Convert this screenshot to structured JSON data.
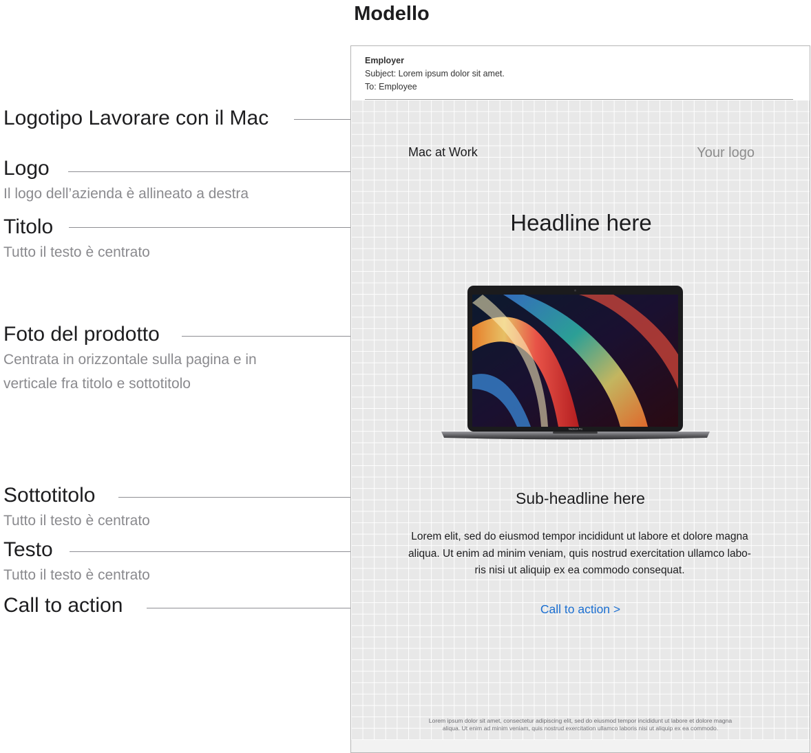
{
  "page": {
    "title": "Modello"
  },
  "annotations": {
    "logotipo": {
      "label": "Logotipo Lavorare con il Mac"
    },
    "logo": {
      "label": "Logo",
      "desc": "Il logo dell’azienda è allineato a destra"
    },
    "titolo": {
      "label": "Titolo",
      "desc": "Tutto il testo è centrato"
    },
    "foto": {
      "label": "Foto del prodotto",
      "desc_line1": "Centrata in orizzontale sulla pagina e in",
      "desc_line2": "verticale fra titolo e sottotitolo"
    },
    "sottotitolo": {
      "label": "Sottotitolo",
      "desc": "Tutto il testo è centrato"
    },
    "testo": {
      "label": "Testo",
      "desc": "Tutto il testo è centrato"
    },
    "cta": {
      "label": "Call to action"
    }
  },
  "email": {
    "from": "Employer",
    "subject": "Subject: Lorem ipsum dolor sit amet.",
    "to": "To: Employee",
    "mac_at_work": "Mac at Work",
    "your_logo": "Your logo",
    "headline": "Headline here",
    "laptop_brand": "MacBook Pro",
    "subheadline": "Sub-headline here",
    "body_line1": "Lorem elit, sed do eiusmod tempor incididunt ut labore et dolore magna",
    "body_line2": "aliqua. Ut enim ad minim veniam, quis nostrud exercitation ullamco labo-",
    "body_line3": "ris nisi ut aliquip ex ea commodo consequat.",
    "cta": "Call to action >",
    "footer_line1": "Lorem ipsum dolor sit amet, consectetur adipiscing elit, sed do eiusmod tempor incididunt ut labore et dolore magna",
    "footer_line2": "aliqua. Ut enim ad minim veniam, quis nostrud exercitation ullamco laboris nisi ut aliquip ex ea commodo."
  },
  "colors": {
    "link": "#1b6fd1",
    "grid_bg": "#e8e8e8",
    "annotation_desc": "#8a8a8e"
  },
  "icons": {
    "product": "laptop-image"
  }
}
